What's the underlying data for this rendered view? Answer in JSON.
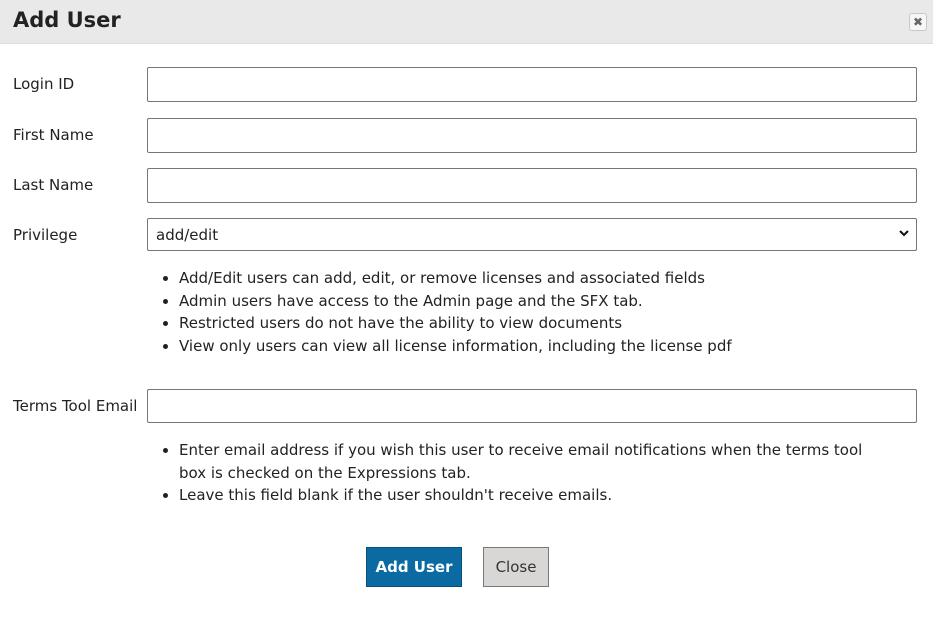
{
  "dialog": {
    "title": "Add User",
    "close_icon": "close-icon"
  },
  "form": {
    "login_id": {
      "label": "Login ID",
      "value": ""
    },
    "first_name": {
      "label": "First Name",
      "value": ""
    },
    "last_name": {
      "label": "Last Name",
      "value": ""
    },
    "privilege": {
      "label": "Privilege",
      "selected": "add/edit",
      "notes": [
        "Add/Edit users can add, edit, or remove licenses and associated fields",
        "Admin users have access to the Admin page and the SFX tab.",
        "Restricted users do not have the ability to view documents",
        "View only users can view all license information, including the license pdf"
      ]
    },
    "terms_tool_email": {
      "label": "Terms Tool Email",
      "value": "",
      "notes": [
        "Enter email address if you wish this user to receive email notifications when the terms tool box is checked on the Expressions tab.",
        "Leave this field blank if the user shouldn't receive emails."
      ]
    }
  },
  "buttons": {
    "add_user": "Add User",
    "close": "Close"
  },
  "colors": {
    "primary_button": "#0a6aa1",
    "secondary_button": "#d8d7d5",
    "titlebar": "#e9e9e9"
  }
}
